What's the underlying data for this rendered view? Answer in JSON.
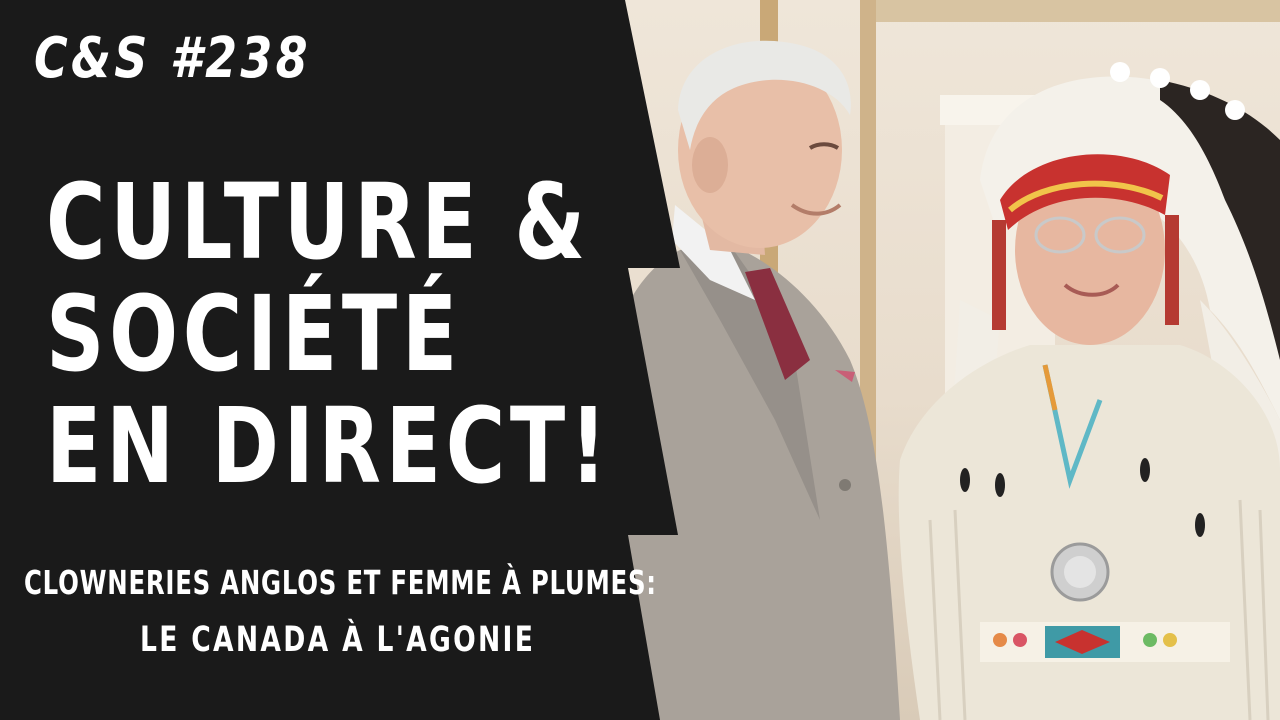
{
  "episode_label": "C&S #238",
  "headline": {
    "line1": "CULTURE &",
    "line2": "SOCIÉTÉ",
    "line3": "EN DIRECT!"
  },
  "subtitle": {
    "line1": "CLOWNERIES ANGLOS ET FEMME À PLUMES:",
    "line2": "LE CANADA À L'AGONIE"
  },
  "colors": {
    "panel": "#1a1a1a",
    "text": "#ffffff",
    "suit": "#a9a29a",
    "headdress_red": "#c8322f",
    "feathers": "#f4f1ea",
    "dress": "#ece6d8",
    "wall": "#e8dccc"
  },
  "photo": {
    "subject_left": "man-in-grey-suit",
    "subject_right": "woman-in-feather-headdress"
  }
}
